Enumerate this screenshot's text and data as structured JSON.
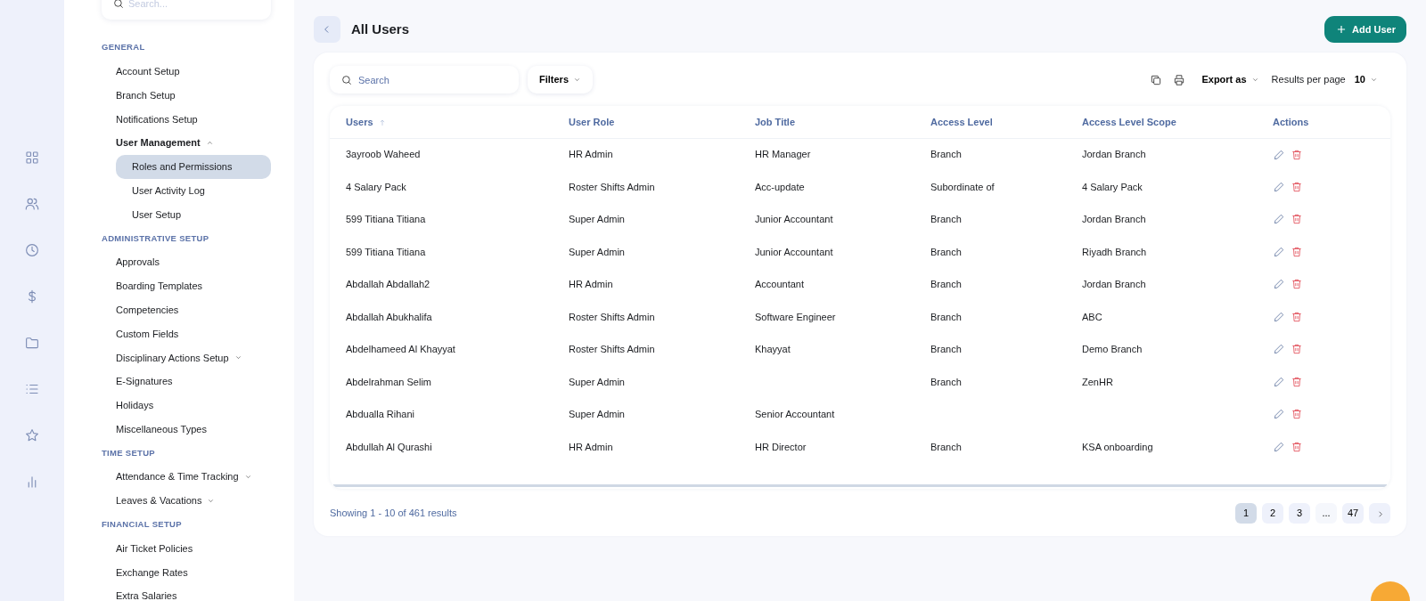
{
  "sidebar": {
    "search": {
      "placeholder": "Search..."
    },
    "sections": [
      {
        "title": "GENERAL",
        "items": [
          {
            "label": "Account Setup",
            "selected": false
          },
          {
            "label": "Branch Setup",
            "selected": false
          },
          {
            "label": "Notifications Setup",
            "selected": false
          },
          {
            "label": "User Management",
            "selected": false,
            "expanded": true,
            "children": [
              {
                "label": "Roles and Permissions",
                "selected": true
              },
              {
                "label": "User Activity Log",
                "selected": false
              },
              {
                "label": "User Setup",
                "selected": false
              }
            ]
          }
        ]
      },
      {
        "title": "ADMINISTRATIVE SETUP",
        "items": [
          {
            "label": "Approvals",
            "selected": false
          },
          {
            "label": "Boarding Templates",
            "selected": false
          },
          {
            "label": "Competencies",
            "selected": false
          },
          {
            "label": "Custom Fields",
            "selected": false
          },
          {
            "label": "Disciplinary Actions Setup",
            "selected": false,
            "expanded": false
          },
          {
            "label": "E-Signatures",
            "selected": false
          },
          {
            "label": "Holidays",
            "selected": false
          },
          {
            "label": "Miscellaneous Types",
            "selected": false
          }
        ]
      },
      {
        "title": "TIME SETUP",
        "items": [
          {
            "label": "Attendance & Time Tracking",
            "selected": false,
            "expanded": false
          },
          {
            "label": "Leaves & Vacations",
            "selected": false,
            "expanded": false
          }
        ]
      },
      {
        "title": "FINANCIAL SETUP",
        "items": [
          {
            "label": "Air Ticket Policies",
            "selected": false
          },
          {
            "label": "Exchange Rates",
            "selected": false
          },
          {
            "label": "Extra Salaries",
            "selected": false
          }
        ]
      }
    ]
  },
  "page": {
    "title": "All Users",
    "add_button": "Add User"
  },
  "toolbar": {
    "search": {
      "placeholder": "Search"
    },
    "filters": "Filters",
    "export": "Export as",
    "results_label": "Results per page",
    "results_value": "10"
  },
  "table": {
    "columns": [
      {
        "label": "Users",
        "sorted": true
      },
      {
        "label": "User Role",
        "sorted": false
      },
      {
        "label": "Job Title",
        "sorted": false
      },
      {
        "label": "Access Level",
        "sorted": false
      },
      {
        "label": "Access Level Scope",
        "sorted": false
      },
      {
        "label": "Actions",
        "sorted": false
      }
    ],
    "rows": [
      [
        "3ayroob Waheed",
        "HR Admin",
        "HR Manager",
        "Branch",
        "Jordan Branch"
      ],
      [
        "4 Salary Pack",
        "Roster Shifts Admin",
        "Acc-update",
        "Subordinate of",
        "4 Salary Pack"
      ],
      [
        "599 Titiana Titiana",
        "Super Admin",
        "Junior Accountant",
        "Branch",
        "Jordan Branch"
      ],
      [
        "599 Titiana Titiana",
        "Super Admin",
        "Junior Accountant",
        "Branch",
        "Riyadh Branch"
      ],
      [
        "Abdallah Abdallah2",
        "HR Admin",
        "Accountant",
        "Branch",
        "Jordan Branch"
      ],
      [
        "Abdallah Abukhalifa",
        "Roster Shifts Admin",
        "Software Engineer",
        "Branch",
        "ABC"
      ],
      [
        "Abdelhameed Al Khayyat",
        "Roster Shifts Admin",
        "Khayyat",
        "Branch",
        "Demo Branch"
      ],
      [
        "Abdelrahman Selim",
        "Super Admin",
        "",
        "Branch",
        "ZenHR"
      ],
      [
        "Abdualla Rihani",
        "Super Admin",
        "Senior Accountant",
        "",
        ""
      ],
      [
        "Abdullah Al Qurashi",
        "HR Admin",
        "HR Director",
        "Branch",
        "KSA onboarding"
      ]
    ]
  },
  "footer": {
    "summary": "Showing 1 - 10 of 461 results",
    "pages": [
      {
        "label": "1",
        "kind": "page",
        "selected": true
      },
      {
        "label": "2",
        "kind": "page",
        "selected": false
      },
      {
        "label": "3",
        "kind": "page",
        "selected": false
      },
      {
        "label": "...",
        "kind": "ellipsis",
        "selected": false
      },
      {
        "label": "47",
        "kind": "page",
        "selected": false
      }
    ]
  }
}
